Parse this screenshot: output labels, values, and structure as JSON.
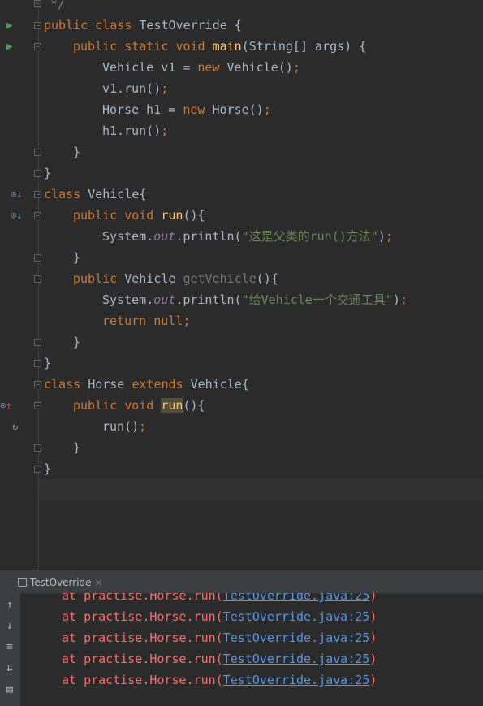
{
  "editor": {
    "comment_close": "*/",
    "kw_public": "public",
    "kw_class": "class",
    "kw_static": "static",
    "kw_void": "void",
    "kw_new": "new",
    "kw_return": "return",
    "kw_null": "null",
    "kw_extends": "extends",
    "cls_test": "TestOverride",
    "cls_vehicle": "Vehicle",
    "cls_horse": "Horse",
    "cls_system": "System",
    "fn_main": "main",
    "fn_run": "run",
    "fn_getvehicle": "getVehicle",
    "fld_out": "out",
    "main_params": "(String[] args) {",
    "open_brace": " {",
    "brace_open_tight": "{",
    "paren_brace": "(){",
    "close_brace": "}",
    "semicolon": ";",
    "v1_decl": "Vehicle v1 = ",
    "v1_ctor": " Vehicle()",
    "v1_run": "v1.run()",
    "h1_decl": "Horse h1 = ",
    "h1_ctor": " Horse()",
    "h1_run": "h1.run()",
    "println_pre": ".println(",
    "println_close": ")",
    "str_parent_run": "\"这是父类的run()方法\"",
    "str_give_vehicle": "\"给Vehicle一个交通工具\"",
    "recursive_run": "run()",
    "dot": "."
  },
  "run_panel": {
    "tab_label": "TestOverride",
    "tab_close": "×",
    "stack_prefix": "at practise.Horse.run(",
    "stack_link": "TestOverride.java:25",
    "stack_suffix": ")",
    "stack_lines": 5
  },
  "colors": {
    "background": "#2b2b2b",
    "keyword": "#cc7832",
    "method": "#ffc66d",
    "string": "#6a8759",
    "field": "#9876aa",
    "error": "#ff6b68",
    "link": "#5394ec"
  },
  "icons": [
    "run-icon",
    "override-down-icon",
    "overrides-up-icon",
    "recursion-icon",
    "arrow-up-icon",
    "arrow-down-icon",
    "soft-wrap-icon",
    "scroll-to-end-icon",
    "print-icon"
  ]
}
